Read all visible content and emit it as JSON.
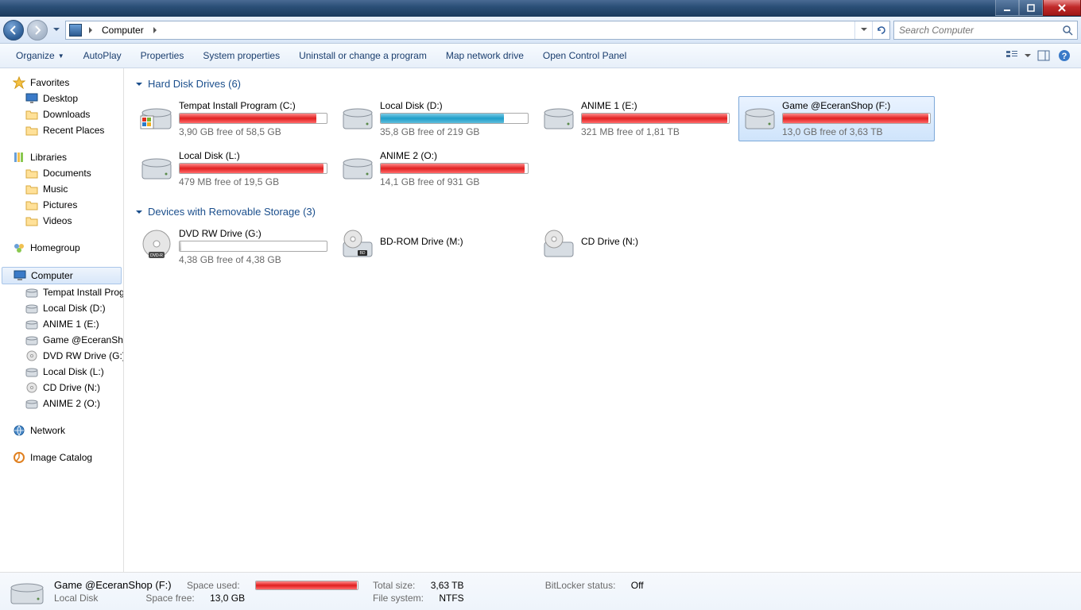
{
  "titlebar": {
    "minimize": "Minimize",
    "maximize": "Maximize",
    "close": "Close"
  },
  "nav": {
    "location": "Computer",
    "search_placeholder": "Search Computer"
  },
  "toolbar": {
    "organize": "Organize",
    "autoplay": "AutoPlay",
    "properties": "Properties",
    "sysprops": "System properties",
    "uninstall": "Uninstall or change a program",
    "mapdrive": "Map network drive",
    "opencp": "Open Control Panel"
  },
  "sidebar": {
    "favorites": {
      "label": "Favorites",
      "items": [
        "Desktop",
        "Downloads",
        "Recent Places"
      ]
    },
    "libraries": {
      "label": "Libraries",
      "items": [
        "Documents",
        "Music",
        "Pictures",
        "Videos"
      ]
    },
    "homegroup": {
      "label": "Homegroup"
    },
    "computer": {
      "label": "Computer",
      "items": [
        "Tempat Install Prog",
        "Local Disk (D:)",
        "ANIME 1 (E:)",
        "Game @EceranShop",
        "DVD RW Drive (G:)",
        "Local Disk (L:)",
        "CD Drive (N:)",
        "ANIME 2 (O:)"
      ]
    },
    "network": {
      "label": "Network"
    },
    "imgcat": {
      "label": "Image Catalog"
    }
  },
  "groups": {
    "hdd": {
      "label": "Hard Disk Drives (6)"
    },
    "removable": {
      "label": "Devices with Removable Storage (3)"
    }
  },
  "drives_hdd": [
    {
      "name": "Tempat Install Program (C:)",
      "free": "3,90 GB free of 58,5 GB",
      "pct": 93,
      "color": "red",
      "icon": "os"
    },
    {
      "name": "Local Disk (D:)",
      "free": "35,8 GB free of 219 GB",
      "pct": 84,
      "color": "blue",
      "icon": "hdd"
    },
    {
      "name": "ANIME 1 (E:)",
      "free": "321 MB free of 1,81 TB",
      "pct": 99,
      "color": "red",
      "icon": "hdd"
    },
    {
      "name": "Game @EceranShop (F:)",
      "free": "13,0 GB free of 3,63 TB",
      "pct": 99,
      "color": "red",
      "icon": "hdd",
      "selected": true
    },
    {
      "name": "Local Disk (L:)",
      "free": "479 MB free of 19,5 GB",
      "pct": 98,
      "color": "red",
      "icon": "hdd"
    },
    {
      "name": "ANIME 2 (O:)",
      "free": "14,1 GB free of 931 GB",
      "pct": 98,
      "color": "red",
      "icon": "hdd"
    }
  ],
  "drives_rem": [
    {
      "name": "DVD RW Drive (G:)",
      "free": "4,38 GB free of 4,38 GB",
      "pct": 1,
      "color": "grey",
      "icon": "dvd"
    },
    {
      "name": "BD-ROM Drive (M:)",
      "icon": "bd",
      "nobar": true
    },
    {
      "name": "CD Drive (N:)",
      "icon": "cd",
      "nobar": true
    }
  ],
  "details": {
    "title": "Game @EceranShop (F:)",
    "subtitle": "Local Disk",
    "lbl_used": "Space used:",
    "lbl_free": "Space free:",
    "lbl_total": "Total size:",
    "lbl_fs": "File system:",
    "lbl_bl": "BitLocker status:",
    "val_free": "13,0 GB",
    "val_total": "3,63 TB",
    "val_fs": "NTFS",
    "val_bl": "Off"
  }
}
